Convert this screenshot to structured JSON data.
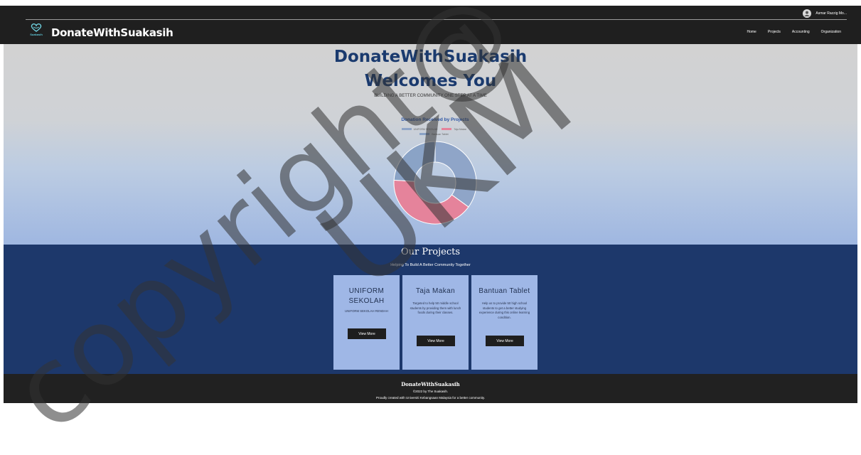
{
  "header": {
    "user_name": "Asmar Razzig Mo...",
    "logo_caption": "Suakasih",
    "brand": "DonateWithSuakasih",
    "nav": [
      "Home",
      "Projects",
      "Accounting",
      "Organization"
    ]
  },
  "hero": {
    "title_line1": "DonateWithSuakasih",
    "title_line2": "Welcomes You",
    "tagline": "BUILDING A BETTER COMMUNITY ONE STEP AT A TIME"
  },
  "chart_data": {
    "type": "pie",
    "title": "Donation Received by Projects",
    "categories": [
      "UNIFORM SEKOLAH",
      "Taja Makan",
      "Bantuan Tablet"
    ],
    "values": [
      35,
      41,
      24
    ],
    "colors": [
      "#8fa5c8",
      "#e5839b",
      "#8aa3c6"
    ],
    "legend_position": "top"
  },
  "projects": {
    "title": "Our Projects",
    "subtitle": "Helping To Build A Better Community Together",
    "cards": [
      {
        "title": "UNIFORM SEKOLAH",
        "desc": "UNIFORM SEKOLAH RENDAH",
        "button": "View More"
      },
      {
        "title": "Taja Makan",
        "desc": "Targeted to help 50 middle school students by providing them with lunch foods during their classes.",
        "button": "View More"
      },
      {
        "title": "Bantuan Tablet",
        "desc": "Help us to provide 50 high school students to get a better studying experience during this online learning condition.",
        "button": "View More"
      }
    ]
  },
  "footer": {
    "brand": "DonateWithSuakasih",
    "copyright": "©2022 by The Suakasih.",
    "made_by": "Proudly created with Universiti Kebangsaan Malaysia for a better community."
  },
  "watermark": {
    "text1": "copyright@",
    "text2": "UKM"
  },
  "colors": {
    "header_bg": "#1f1f1f",
    "hero_title": "#1a3a6e",
    "projects_bg": "#1d386b",
    "card_bg": "#9fb7e6",
    "button_bg": "#1e1e1e",
    "footer_bg": "#212121"
  }
}
